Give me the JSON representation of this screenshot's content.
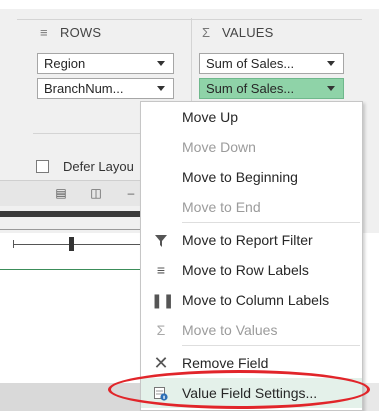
{
  "rows_area": {
    "header": "ROWS",
    "fields": [
      {
        "label": "Region"
      },
      {
        "label": "BranchNum..."
      }
    ]
  },
  "values_area": {
    "header": "VALUES",
    "fields": [
      {
        "label": "Sum of Sales..."
      },
      {
        "label": "Sum of Sales..."
      }
    ]
  },
  "defer_layout": {
    "label": "Defer Layou"
  },
  "context_menu": {
    "items": [
      {
        "label": "Move Up",
        "enabled": true
      },
      {
        "label": "Move Down",
        "enabled": false
      },
      {
        "label": "Move to Beginning",
        "enabled": true
      },
      {
        "label": "Move to End",
        "enabled": false
      },
      {
        "label": "Move to Report Filter",
        "enabled": true
      },
      {
        "label": "Move to Row Labels",
        "enabled": true
      },
      {
        "label": "Move to Column Labels",
        "enabled": true
      },
      {
        "label": "Move to Values",
        "enabled": false
      },
      {
        "label": "Remove Field",
        "enabled": true
      },
      {
        "label": "Value Field Settings...",
        "enabled": true,
        "highlighted": true
      }
    ]
  },
  "colors": {
    "selected_field": "#8fd3a8",
    "annotation_ellipse": "#e1252a",
    "menu_highlight": "#e4f1ea"
  }
}
